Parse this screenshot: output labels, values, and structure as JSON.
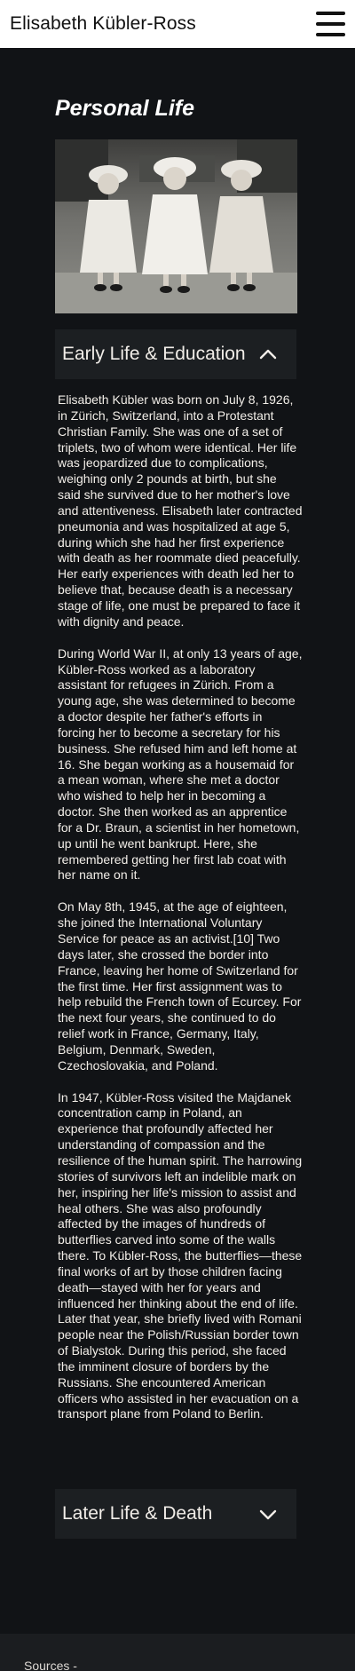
{
  "header": {
    "title": "Elisabeth Kübler-Ross",
    "menu_icon": "hamburger-menu-icon"
  },
  "section": {
    "title": "Personal Life",
    "photo_alt": "Black and white photograph of three young girls (triplets) in dresses and bonnets"
  },
  "accordion_1": {
    "label": "Early Life & Education",
    "state": "expanded",
    "icon": "chevron-up-icon"
  },
  "paragraphs": [
    "Elisabeth Kübler was born on July 8, 1926, in Zürich, Switzerland, into a Protestant Christian Family. She was one of a set of triplets, two of whom were identical. Her life was jeopardized due to complications, weighing only 2 pounds at birth, but she said she survived due to her mother's love and attentiveness. Elisabeth later contracted pneumonia and was hospitalized at age 5, during which she had her first experience with death as her roommate died peacefully. Her early experiences with death led her to believe that, because death is a necessary stage of life, one must be prepared to face it with dignity and peace.",
    "During World War II, at only 13 years of age, Kübler-Ross worked as a laboratory assistant for refugees in Zürich. From a young age, she was determined to become a doctor despite her father's efforts in forcing her to become a secretary for his business. She refused him and left home at 16. She began working as a housemaid for a mean woman, where she met a doctor who wished to help her in becoming a doctor. She then worked as an apprentice for a Dr. Braun, a scientist in her hometown, up until he went bankrupt. Here, she remembered getting her first lab coat with her name on it.",
    "On May 8th, 1945, at the age of eighteen, she joined the International Voluntary Service for peace as an activist.[10] Two days later, she crossed the border into France, leaving her home of Switzerland for the first time. Her first assignment was to help rebuild the French town of Ecurcey. For the next four years, she continued to do relief work in France, Germany, Italy, Belgium, Denmark, Sweden, Czechoslovakia, and Poland.",
    "In 1947, Kübler-Ross visited the Majdanek concentration camp in Poland, an experience that profoundly affected her understanding of compassion and the resilience of the human spirit. The harrowing stories of survivors left an indelible mark on her, inspiring her life's mission to assist and heal others. She was also profoundly affected by the images of hundreds of butterflies carved into some of the walls there. To Kübler-Ross, the butterflies—these final works of art by those children facing death—stayed with her for years and influenced her thinking about the end of life. Later that year, she briefly lived with Romani people near the Polish/Russian border town of Bialystok. During this period, she faced the imminent closure of borders by the Russians. She encountered American officers who assisted in her evacuation on a transport plane from Poland to Berlin."
  ],
  "accordion_2": {
    "label": "Later Life & Death",
    "state": "collapsed",
    "icon": "chevron-down-icon"
  },
  "footer": {
    "sources": "Sources -"
  }
}
